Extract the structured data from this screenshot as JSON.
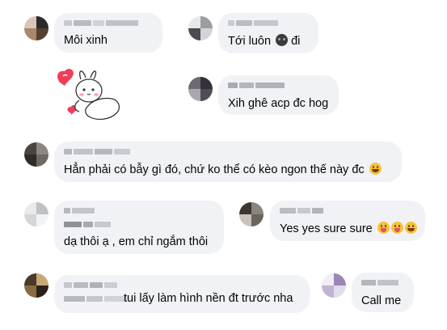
{
  "comments": [
    {
      "id": "c1",
      "text": "Môi xinh",
      "emojis": []
    },
    {
      "id": "c2",
      "text": "Tới luôn",
      "text_after": "đi",
      "emojis": [
        "dark-face-emoji"
      ]
    },
    {
      "id": "c3",
      "sticker": "bunny-hearts-sticker"
    },
    {
      "id": "c4",
      "text": "Xih ghê acp đc hog",
      "emojis": []
    },
    {
      "id": "c5",
      "text": "Hẳn phải có bẫy gì đó, chứ ko thể có kèo ngon thế này đc",
      "emojis": [
        "grin-emoji"
      ]
    },
    {
      "id": "c6",
      "text": "dạ thôi ạ , em chỉ ngắm thôi",
      "emojis": []
    },
    {
      "id": "c7",
      "text": "Yes yes sure sure",
      "emojis": [
        "tongue-emoji",
        "tongue-emoji",
        "grin-emoji"
      ]
    },
    {
      "id": "c8",
      "text": "tui lấy làm hình nền đt trước nha",
      "emojis": []
    },
    {
      "id": "c9",
      "text": "Call me",
      "emojis": []
    }
  ],
  "colors": {
    "bubble": "#f0f2f5",
    "text": "#050505",
    "blur_name": "#b9bcc1",
    "heart": "#f03e5a",
    "emoji_yellow": "#f6c23a"
  }
}
